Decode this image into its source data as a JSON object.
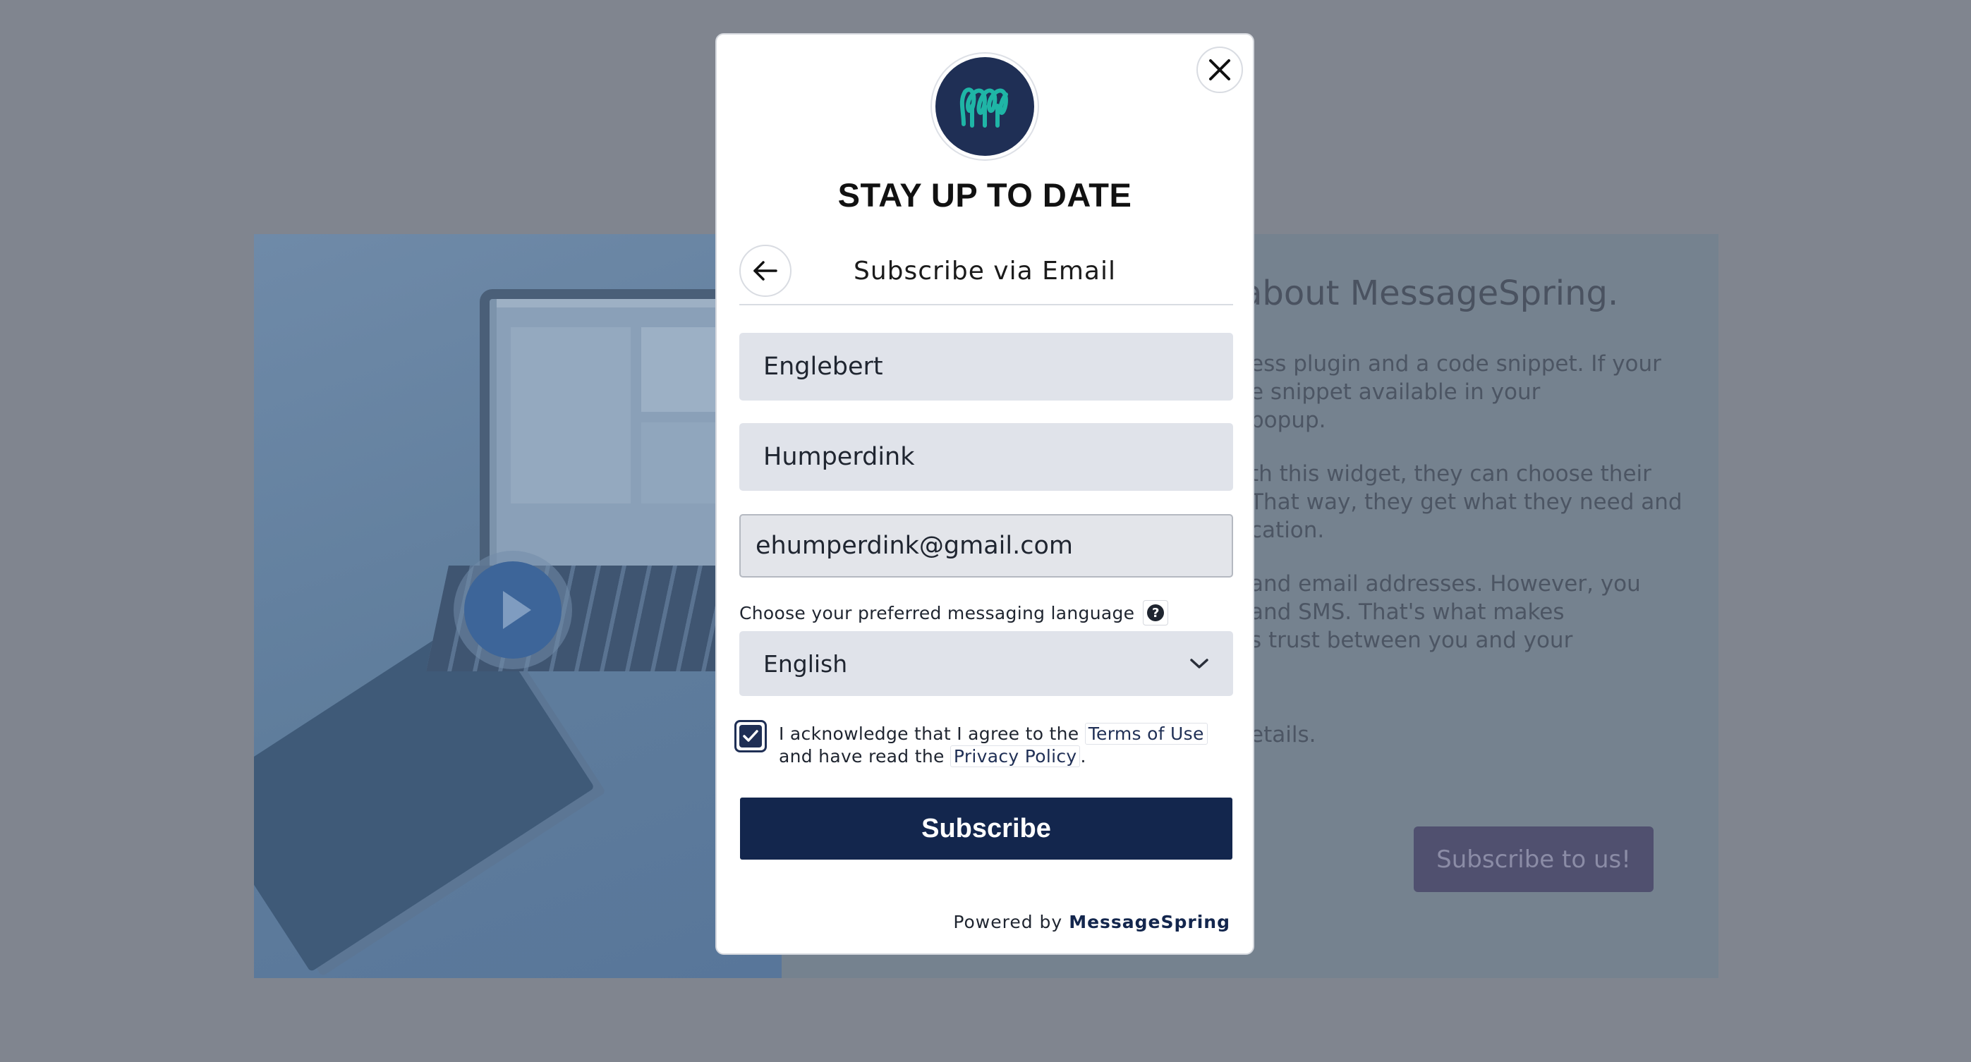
{
  "background": {
    "heading": "about MessageSpring.",
    "paragraphs": [
      [
        "ess plugin and a code snippet. If your",
        "e snippet available in your",
        "popup."
      ],
      [
        "th this widget, they can choose their",
        "That way, they get what they need and",
        "cation."
      ],
      [
        " and email addresses.  However, you",
        "and SMS. That's what makes",
        "s trust between you and your"
      ],
      [
        "etails."
      ]
    ],
    "cta_label": "Subscribe to us!"
  },
  "modal": {
    "title": "STAY UP TO DATE",
    "subtitle": "Subscribe via Email",
    "fields": {
      "first_name": "Englebert",
      "last_name": "Humperdink",
      "email": "ehumperdink@gmail.com"
    },
    "language_label": "Choose your preferred messaging language",
    "help_icon_text": "?",
    "language_selected": "English",
    "consent": {
      "checked": true,
      "text_before": "I acknowledge that I agree to the",
      "terms_link": "Terms of Use",
      "text_middle": "and have read the",
      "privacy_link": "Privacy Policy",
      "text_after": "."
    },
    "subscribe_label": "Subscribe",
    "powered_prefix": "Powered by",
    "powered_brand": "MessageSpring"
  },
  "colors": {
    "overlay": "#80858f",
    "brand_navy": "#13264d",
    "logo_bg": "#1f2f55",
    "logo_mark": "#1fb5a6",
    "field_bg": "#e0e3ea"
  },
  "icons": {
    "close": "close-icon",
    "back": "arrow-left-icon",
    "logo": "messagespring-logo",
    "help": "question-circle-icon",
    "dropdown": "chevron-down-icon",
    "check": "check-icon",
    "play": "play-icon"
  }
}
